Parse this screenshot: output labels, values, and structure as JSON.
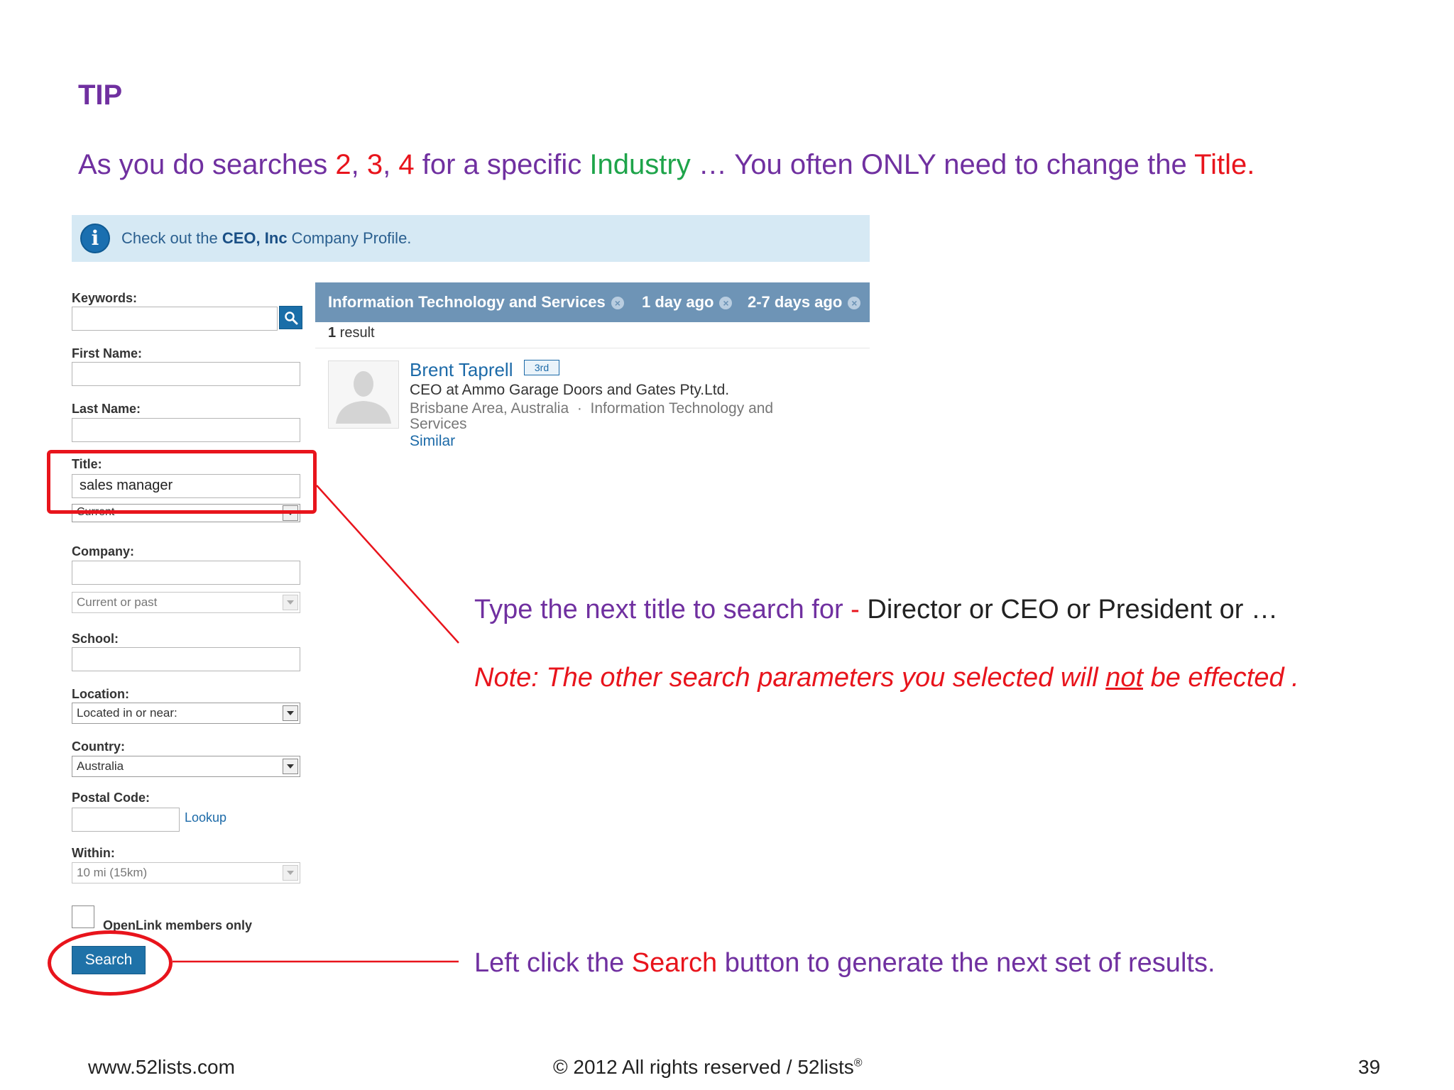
{
  "slide": {
    "heading": "TIP",
    "headline": {
      "p1": "As you do searches ",
      "n2": "2",
      "sep1": ", ",
      "n3": "3",
      "sep2": ", ",
      "n4": "4",
      "p2": " for a specific ",
      "industry": "Industry",
      "p3": " … You often ONLY need to change the ",
      "title": "Title."
    }
  },
  "banner": {
    "icon": "info-icon",
    "prefix": "Check out the ",
    "company": "CEO, Inc",
    "suffix": " Company Profile."
  },
  "form": {
    "keywords_label": "Keywords:",
    "keywords_value": "",
    "first_name_label": "First Name:",
    "last_name_label": "Last Name:",
    "title_label": "Title:",
    "title_value": "sales manager",
    "title_scope": "Current",
    "company_label": "Company:",
    "company_scope": "Current or past",
    "school_label": "School:",
    "location_label": "Location:",
    "location_value": "Located in or near:",
    "country_label": "Country:",
    "country_value": "Australia",
    "postal_label": "Postal Code:",
    "lookup_link": "Lookup",
    "within_label": "Within:",
    "within_value": "10 mi (15km)",
    "openlink_label": "OpenLink members only",
    "search_button": "Search"
  },
  "results": {
    "facets": [
      {
        "label": "Information Technology and Services"
      },
      {
        "label": "1 day ago"
      },
      {
        "label": "2-7 days ago"
      }
    ],
    "count_num": "1",
    "count_word": " result",
    "person": {
      "name": "Brent Taprell",
      "degree": "3rd",
      "headline": "CEO at Ammo Garage Doors and Gates Pty.Ltd.",
      "location": "Brisbane Area, Australia",
      "bullet": "·",
      "industry_line1": "Information Technology and",
      "industry_line2": "Services",
      "similar": "Similar"
    }
  },
  "annotations": {
    "title_tip": {
      "p1": "Type the next title to search for ",
      "dash": "- ",
      "p2": "Director or CEO or President or …"
    },
    "note": {
      "p1": "Note: The other search parameters you selected  will ",
      "not": "not",
      "p2": " be effected ."
    },
    "search_tip": {
      "p1": "Left click the ",
      "search": "Search",
      "p2": " button to generate the next set of results."
    }
  },
  "footer": {
    "url": "www.52lists.com",
    "copyright": "© 2012 All rights reserved / 52lists",
    "reg": "®",
    "page": "39"
  },
  "colors": {
    "purple": "#7030a0",
    "red": "#e8141c",
    "green": "#1ea44a",
    "link_blue": "#1c6aa8",
    "facet_bar": "#6e94b6",
    "banner_bg": "#d6e9f4"
  }
}
